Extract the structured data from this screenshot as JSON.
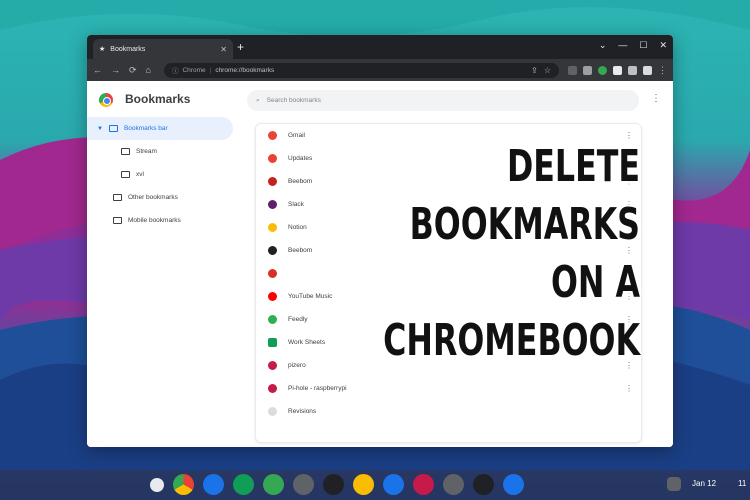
{
  "window": {
    "tab_title": "Bookmarks",
    "tab_close": "✕",
    "new_tab": "+",
    "controls": [
      "⌄",
      "—",
      "☐",
      "✕"
    ]
  },
  "toolbar": {
    "back": "←",
    "forward": "→",
    "reload": "⟳",
    "home": "⌂",
    "site_label": "Chrome",
    "url_sep": "|",
    "url": "chrome://bookmarks"
  },
  "header": {
    "title": "Bookmarks",
    "search_placeholder": "Search bookmarks",
    "menu": "⋮"
  },
  "sidebar": {
    "items": [
      {
        "label": "Bookmarks bar"
      },
      {
        "label": "Stream"
      },
      {
        "label": "xvl"
      },
      {
        "label": "Other bookmarks"
      },
      {
        "label": "Mobile bookmarks"
      }
    ]
  },
  "bookmarks": [
    {
      "label": "Gmail",
      "color": "#ea4335"
    },
    {
      "label": "Updates",
      "color": "#ea4335"
    },
    {
      "label": "Beebom",
      "color": "#c5221f"
    },
    {
      "label": "Slack",
      "color": "#611f69"
    },
    {
      "label": "Notion",
      "color": "#fbbc04"
    },
    {
      "label": "Beebom",
      "color": "#202124"
    },
    {
      "label": "",
      "color": "#d93025"
    },
    {
      "label": "YouTube Music",
      "color": "#ff0000"
    },
    {
      "label": "Feedly",
      "color": "#2bb24c"
    },
    {
      "label": "Work Sheets",
      "color": "#0f9d58"
    },
    {
      "label": "pizero",
      "color": "#c51a4a"
    },
    {
      "label": "Pi-hole - raspberrypi",
      "color": "#c51a4a"
    },
    {
      "label": "Revisions",
      "color": "#dadce0"
    }
  ],
  "row_menu": "⋮",
  "overlay": {
    "line1": "DELETE",
    "line2": "BOOKMARKS",
    "line3": "ON A CHROMEBOOK"
  },
  "shelf": {
    "apps": [
      {
        "name": "launcher-icon",
        "color": "#e8eaed"
      },
      {
        "name": "chrome-icon",
        "color": "#4285f4"
      },
      {
        "name": "files-icon",
        "color": "#1a73e8"
      },
      {
        "name": "sheets-icon",
        "color": "#0f9d58"
      },
      {
        "name": "play-store-icon",
        "color": "#34a853"
      },
      {
        "name": "app-icon-1",
        "color": "#5f6368"
      },
      {
        "name": "app-icon-2",
        "color": "#202124"
      },
      {
        "name": "app-icon-3",
        "color": "#fbbc04"
      },
      {
        "name": "app-icon-4",
        "color": "#1a73e8"
      },
      {
        "name": "app-icon-5",
        "color": "#c51a4a"
      },
      {
        "name": "settings-icon",
        "color": "#5f6368"
      },
      {
        "name": "terminal-icon",
        "color": "#202124"
      },
      {
        "name": "app-icon-6",
        "color": "#1a73e8"
      }
    ],
    "date": "Jan 12",
    "time": "11"
  }
}
